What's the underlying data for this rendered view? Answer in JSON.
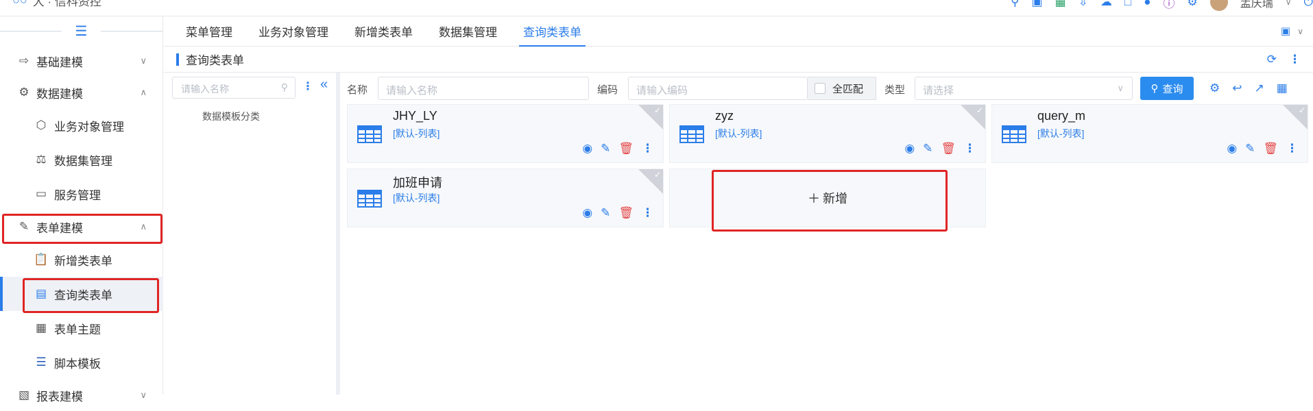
{
  "header": {
    "app_title": "大 · 信科资控",
    "user_name": "孟庆瑞"
  },
  "sidebar": {
    "items": [
      {
        "label": "基础建模",
        "icon": "logout-icon",
        "expanded": false
      },
      {
        "label": "数据建模",
        "icon": "gears-icon",
        "expanded": true
      },
      {
        "label": "业务对象管理",
        "icon": "cube-icon"
      },
      {
        "label": "数据集管理",
        "icon": "tree-icon"
      },
      {
        "label": "服务管理",
        "icon": "drive-icon"
      },
      {
        "label": "表单建模",
        "icon": "edit-icon",
        "expanded": true
      },
      {
        "label": "新增类表单",
        "icon": "clipboard-icon"
      },
      {
        "label": "查询类表单",
        "icon": "server-icon",
        "active": true
      },
      {
        "label": "表单主题",
        "icon": "grid-icon"
      },
      {
        "label": "脚本模板",
        "icon": "menu-icon"
      },
      {
        "label": "报表建模",
        "icon": "report-icon",
        "expanded": false
      }
    ]
  },
  "tabs": [
    "菜单管理",
    "业务对象管理",
    "新增类表单",
    "数据集管理",
    "查询类表单"
  ],
  "active_tab": "查询类表单",
  "page": {
    "title": "查询类表单"
  },
  "left_panel": {
    "search_placeholder": "请输入名称",
    "tree_root": "数据模板分类"
  },
  "filters": {
    "name_label": "名称",
    "name_placeholder": "请输入名称",
    "code_label": "编码",
    "code_placeholder": "请输入编码",
    "exact_match": "全匹配",
    "type_label": "类型",
    "type_placeholder": "请选择",
    "query_button": "查询"
  },
  "cards": [
    {
      "title": "JHY_LY",
      "subtitle": "[默认-列表]"
    },
    {
      "title": "zyz",
      "subtitle": "[默认-列表]"
    },
    {
      "title": "query_m",
      "subtitle": "[默认-列表]"
    },
    {
      "title": "加班申请",
      "subtitle": "[默认-列表]"
    }
  ],
  "add_card": {
    "label": "新增"
  },
  "colors": {
    "accent": "#2b7de9",
    "danger": "#e54848",
    "highlight": "#e02424"
  }
}
